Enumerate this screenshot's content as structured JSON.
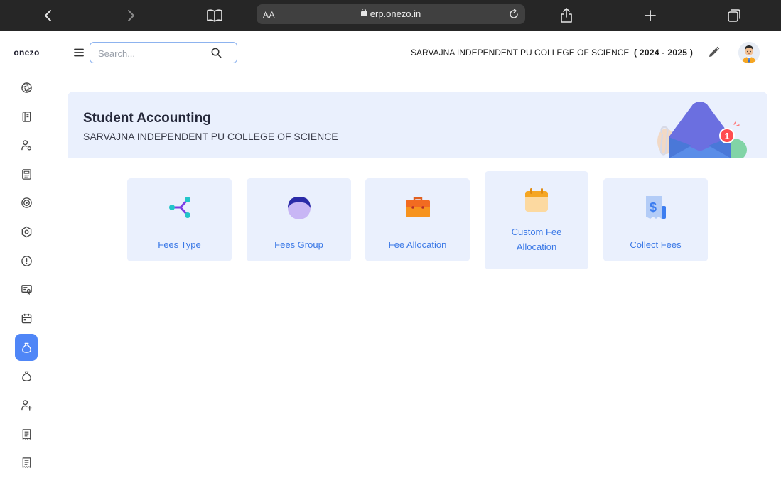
{
  "browser": {
    "url_text_size": "AA",
    "url": "erp.onezo.in"
  },
  "sidebar": {
    "logo": "onezo",
    "items": [
      {
        "icon": "aperture-icon",
        "active": false
      },
      {
        "icon": "book-icon",
        "active": false
      },
      {
        "icon": "user-settings-icon",
        "active": false
      },
      {
        "icon": "calculator-icon",
        "active": false
      },
      {
        "icon": "target-icon",
        "active": false
      },
      {
        "icon": "hexagon-settings-icon",
        "active": false
      },
      {
        "icon": "alert-circle-icon",
        "active": false
      },
      {
        "icon": "certificate-icon",
        "active": false
      },
      {
        "icon": "calendar-icon",
        "active": false
      },
      {
        "icon": "money-bag-icon",
        "active": true
      },
      {
        "icon": "money-bag-icon",
        "active": false
      },
      {
        "icon": "user-plus-icon",
        "active": false
      },
      {
        "icon": "receipt-icon",
        "active": false
      },
      {
        "icon": "receipt-icon",
        "active": false
      }
    ]
  },
  "header": {
    "search_placeholder": "Search...",
    "college_name": "SARVAJNA INDEPENDENT PU COLLEGE OF SCIENCE",
    "academic_year": "( 2024 - 2025 )"
  },
  "banner": {
    "title": "Student Accounting",
    "subtitle": "SARVAJNA INDEPENDENT PU COLLEGE OF SCIENCE",
    "notification_count": "1"
  },
  "cards": [
    {
      "label": "Fees Type",
      "icon": "share-nodes-icon"
    },
    {
      "label": "Fees Group",
      "icon": "person-head-icon"
    },
    {
      "label": "Fee Allocation",
      "icon": "briefcase-icon"
    },
    {
      "label_line1": "Custom Fee",
      "label_line2": "Allocation",
      "icon": "calendar-icon"
    },
    {
      "label": "Collect Fees",
      "icon": "receipt-dollar-icon"
    }
  ],
  "colors": {
    "accent": "#4f86f7",
    "card_bg": "#eaf0fd",
    "card_text": "#3a78e6",
    "browser_bar": "#262626"
  }
}
